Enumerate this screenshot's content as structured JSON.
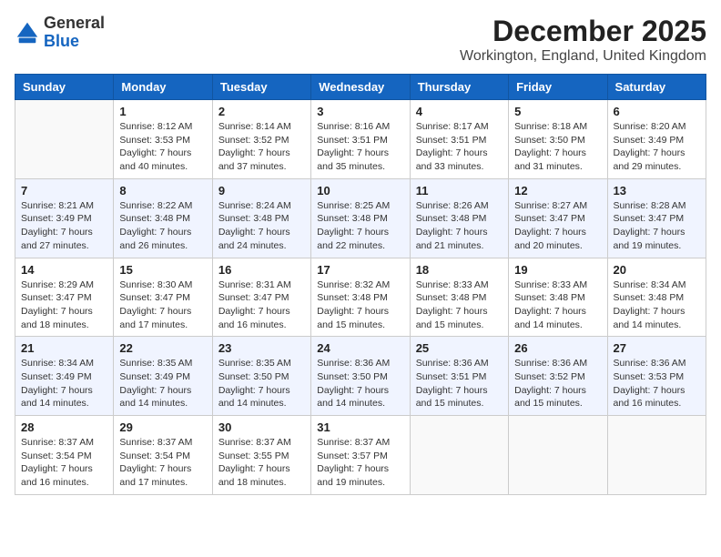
{
  "header": {
    "logo_general": "General",
    "logo_blue": "Blue",
    "month_title": "December 2025",
    "location": "Workington, England, United Kingdom"
  },
  "days_of_week": [
    "Sunday",
    "Monday",
    "Tuesday",
    "Wednesday",
    "Thursday",
    "Friday",
    "Saturday"
  ],
  "weeks": [
    [
      {
        "day": "",
        "sunrise": "",
        "sunset": "",
        "daylight": ""
      },
      {
        "day": "1",
        "sunrise": "Sunrise: 8:12 AM",
        "sunset": "Sunset: 3:53 PM",
        "daylight": "Daylight: 7 hours and 40 minutes."
      },
      {
        "day": "2",
        "sunrise": "Sunrise: 8:14 AM",
        "sunset": "Sunset: 3:52 PM",
        "daylight": "Daylight: 7 hours and 37 minutes."
      },
      {
        "day": "3",
        "sunrise": "Sunrise: 8:16 AM",
        "sunset": "Sunset: 3:51 PM",
        "daylight": "Daylight: 7 hours and 35 minutes."
      },
      {
        "day": "4",
        "sunrise": "Sunrise: 8:17 AM",
        "sunset": "Sunset: 3:51 PM",
        "daylight": "Daylight: 7 hours and 33 minutes."
      },
      {
        "day": "5",
        "sunrise": "Sunrise: 8:18 AM",
        "sunset": "Sunset: 3:50 PM",
        "daylight": "Daylight: 7 hours and 31 minutes."
      },
      {
        "day": "6",
        "sunrise": "Sunrise: 8:20 AM",
        "sunset": "Sunset: 3:49 PM",
        "daylight": "Daylight: 7 hours and 29 minutes."
      }
    ],
    [
      {
        "day": "7",
        "sunrise": "Sunrise: 8:21 AM",
        "sunset": "Sunset: 3:49 PM",
        "daylight": "Daylight: 7 hours and 27 minutes."
      },
      {
        "day": "8",
        "sunrise": "Sunrise: 8:22 AM",
        "sunset": "Sunset: 3:48 PM",
        "daylight": "Daylight: 7 hours and 26 minutes."
      },
      {
        "day": "9",
        "sunrise": "Sunrise: 8:24 AM",
        "sunset": "Sunset: 3:48 PM",
        "daylight": "Daylight: 7 hours and 24 minutes."
      },
      {
        "day": "10",
        "sunrise": "Sunrise: 8:25 AM",
        "sunset": "Sunset: 3:48 PM",
        "daylight": "Daylight: 7 hours and 22 minutes."
      },
      {
        "day": "11",
        "sunrise": "Sunrise: 8:26 AM",
        "sunset": "Sunset: 3:48 PM",
        "daylight": "Daylight: 7 hours and 21 minutes."
      },
      {
        "day": "12",
        "sunrise": "Sunrise: 8:27 AM",
        "sunset": "Sunset: 3:47 PM",
        "daylight": "Daylight: 7 hours and 20 minutes."
      },
      {
        "day": "13",
        "sunrise": "Sunrise: 8:28 AM",
        "sunset": "Sunset: 3:47 PM",
        "daylight": "Daylight: 7 hours and 19 minutes."
      }
    ],
    [
      {
        "day": "14",
        "sunrise": "Sunrise: 8:29 AM",
        "sunset": "Sunset: 3:47 PM",
        "daylight": "Daylight: 7 hours and 18 minutes."
      },
      {
        "day": "15",
        "sunrise": "Sunrise: 8:30 AM",
        "sunset": "Sunset: 3:47 PM",
        "daylight": "Daylight: 7 hours and 17 minutes."
      },
      {
        "day": "16",
        "sunrise": "Sunrise: 8:31 AM",
        "sunset": "Sunset: 3:47 PM",
        "daylight": "Daylight: 7 hours and 16 minutes."
      },
      {
        "day": "17",
        "sunrise": "Sunrise: 8:32 AM",
        "sunset": "Sunset: 3:48 PM",
        "daylight": "Daylight: 7 hours and 15 minutes."
      },
      {
        "day": "18",
        "sunrise": "Sunrise: 8:33 AM",
        "sunset": "Sunset: 3:48 PM",
        "daylight": "Daylight: 7 hours and 15 minutes."
      },
      {
        "day": "19",
        "sunrise": "Sunrise: 8:33 AM",
        "sunset": "Sunset: 3:48 PM",
        "daylight": "Daylight: 7 hours and 14 minutes."
      },
      {
        "day": "20",
        "sunrise": "Sunrise: 8:34 AM",
        "sunset": "Sunset: 3:48 PM",
        "daylight": "Daylight: 7 hours and 14 minutes."
      }
    ],
    [
      {
        "day": "21",
        "sunrise": "Sunrise: 8:34 AM",
        "sunset": "Sunset: 3:49 PM",
        "daylight": "Daylight: 7 hours and 14 minutes."
      },
      {
        "day": "22",
        "sunrise": "Sunrise: 8:35 AM",
        "sunset": "Sunset: 3:49 PM",
        "daylight": "Daylight: 7 hours and 14 minutes."
      },
      {
        "day": "23",
        "sunrise": "Sunrise: 8:35 AM",
        "sunset": "Sunset: 3:50 PM",
        "daylight": "Daylight: 7 hours and 14 minutes."
      },
      {
        "day": "24",
        "sunrise": "Sunrise: 8:36 AM",
        "sunset": "Sunset: 3:50 PM",
        "daylight": "Daylight: 7 hours and 14 minutes."
      },
      {
        "day": "25",
        "sunrise": "Sunrise: 8:36 AM",
        "sunset": "Sunset: 3:51 PM",
        "daylight": "Daylight: 7 hours and 15 minutes."
      },
      {
        "day": "26",
        "sunrise": "Sunrise: 8:36 AM",
        "sunset": "Sunset: 3:52 PM",
        "daylight": "Daylight: 7 hours and 15 minutes."
      },
      {
        "day": "27",
        "sunrise": "Sunrise: 8:36 AM",
        "sunset": "Sunset: 3:53 PM",
        "daylight": "Daylight: 7 hours and 16 minutes."
      }
    ],
    [
      {
        "day": "28",
        "sunrise": "Sunrise: 8:37 AM",
        "sunset": "Sunset: 3:54 PM",
        "daylight": "Daylight: 7 hours and 16 minutes."
      },
      {
        "day": "29",
        "sunrise": "Sunrise: 8:37 AM",
        "sunset": "Sunset: 3:54 PM",
        "daylight": "Daylight: 7 hours and 17 minutes."
      },
      {
        "day": "30",
        "sunrise": "Sunrise: 8:37 AM",
        "sunset": "Sunset: 3:55 PM",
        "daylight": "Daylight: 7 hours and 18 minutes."
      },
      {
        "day": "31",
        "sunrise": "Sunrise: 8:37 AM",
        "sunset": "Sunset: 3:57 PM",
        "daylight": "Daylight: 7 hours and 19 minutes."
      },
      {
        "day": "",
        "sunrise": "",
        "sunset": "",
        "daylight": ""
      },
      {
        "day": "",
        "sunrise": "",
        "sunset": "",
        "daylight": ""
      },
      {
        "day": "",
        "sunrise": "",
        "sunset": "",
        "daylight": ""
      }
    ]
  ]
}
